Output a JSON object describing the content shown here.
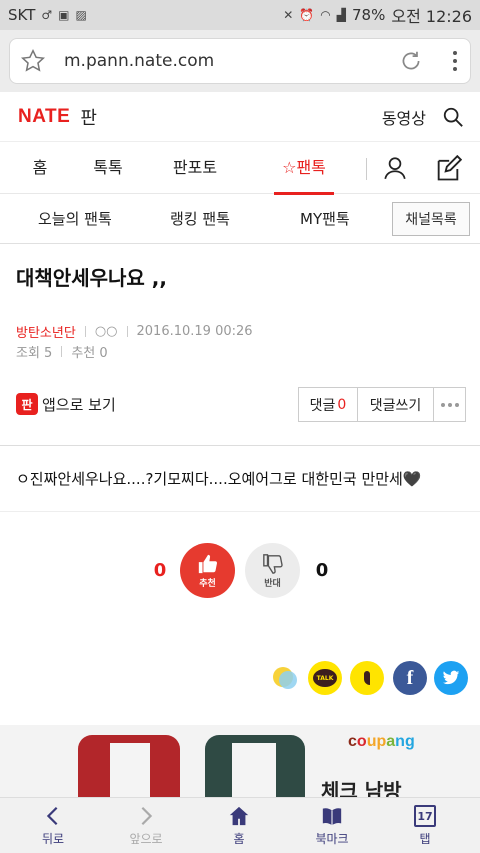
{
  "status_bar": {
    "carrier": "SKT",
    "battery": "78%",
    "time": "오전 12:26"
  },
  "browser": {
    "url": "m.pann.nate.com"
  },
  "header": {
    "logo": "NATE",
    "section": "판",
    "video_link": "동영상"
  },
  "main_nav": {
    "items": [
      {
        "label": "홈"
      },
      {
        "label": "톡톡"
      },
      {
        "label": "판포토"
      },
      {
        "label": "팬톡"
      }
    ],
    "active": "팬톡"
  },
  "sub_nav": {
    "items": [
      {
        "label": "오늘의 팬톡"
      },
      {
        "label": "랭킹 팬톡"
      },
      {
        "label": "MY팬톡"
      }
    ],
    "channel_button": "채널목록"
  },
  "article": {
    "title": "대책안세우나요 ,,",
    "author": "방탄소년단",
    "nickname": "○○",
    "date": "2016.10.19 00:26",
    "views": "조회 5",
    "recommends": "추천 0",
    "app_view_label": "앱으로 보기",
    "app_icon_text": "판",
    "comment_label": "댓글",
    "comment_count": "0",
    "write_comment_label": "댓글쓰기",
    "body": "ㅇ진짜안세우나요....?기모찌다....오예어그로 대한민국 만만세🖤"
  },
  "vote": {
    "up_count": "0",
    "up_label": "추천",
    "down_label": "반대",
    "down_count": "0"
  },
  "share": {
    "icons": [
      "kakao-story-icon",
      "kakaotalk-icon",
      "kakao-page-icon",
      "facebook-icon",
      "twitter-icon"
    ],
    "talk_text": "TALK",
    "facebook_text": "f"
  },
  "ad": {
    "brand": [
      "c",
      "o",
      "u",
      "p",
      "a",
      "n",
      "g"
    ],
    "text": "체크 남방"
  },
  "bottom_bar": {
    "back": "뒤로",
    "forward": "앞으로",
    "home": "홈",
    "bookmark": "북마크",
    "tabs": "탭",
    "tab_count": "17"
  },
  "colors": {
    "brand_red": "#e8211f",
    "vote_red": "#e63a2f",
    "facebook": "#3b5998",
    "twitter": "#1da1f2",
    "kakao_yellow": "#ffe400"
  }
}
